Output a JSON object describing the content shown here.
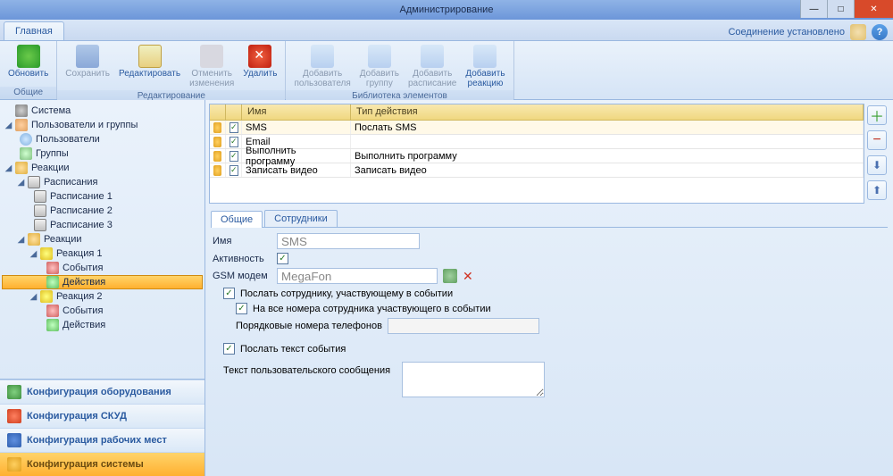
{
  "window": {
    "title": "Администрирование"
  },
  "tabbar": {
    "main": "Главная",
    "conn_status": "Соединение установлено"
  },
  "ribbon": {
    "groups": {
      "g1": {
        "title": "Общие",
        "refresh": "Обновить"
      },
      "g2": {
        "title": "Редактирование",
        "save": "Сохранить",
        "edit": "Редактировать",
        "undo": "Отменить\nизменения",
        "delete": "Удалить"
      },
      "g3": {
        "title": "Библиотека элементов",
        "add_user": "Добавить\nпользователя",
        "add_group": "Добавить\nгруппу",
        "add_sched": "Добавить\nрасписание",
        "add_react": "Добавить\nреакцию"
      }
    }
  },
  "tree": {
    "system": "Система",
    "users_groups": "Пользователи и группы",
    "users": "Пользователи",
    "groups": "Группы",
    "reactions": "Реакции",
    "schedules": "Расписания",
    "sched1": "Расписание 1",
    "sched2": "Расписание 2",
    "sched3": "Расписание 3",
    "reactions2": "Реакции",
    "react1": "Реакция 1",
    "events": "События",
    "actions": "Действия",
    "react2": "Реакция 2"
  },
  "sidebar_bottom": {
    "hw": "Конфигурация оборудования",
    "skud": "Конфигурация СКУД",
    "wp": "Конфигурация рабочих мест",
    "sys": "Конфигурация системы"
  },
  "grid": {
    "col_name": "Имя",
    "col_type": "Тип действия",
    "rows": [
      {
        "name": "SMS",
        "type": "Послать SMS"
      },
      {
        "name": "Email",
        "type": ""
      },
      {
        "name": "Выполнить программу",
        "type": "Выполнить программу"
      },
      {
        "name": "Записать видео",
        "type": "Записать видео"
      }
    ]
  },
  "detail": {
    "tab_general": "Общие",
    "tab_staff": "Сотрудники",
    "name_label": "Имя",
    "name_value": "SMS",
    "activity_label": "Активность",
    "modem_label": "GSM модем",
    "modem_value": "MegaFon",
    "send_participant": "Послать сотруднику, участвующему в событии",
    "all_numbers": "На все номера сотрудника участвующего в событии",
    "ord_numbers_label": "Порядковые номера телефонов",
    "send_text": "Послать текст события",
    "user_msg_label": "Текст пользовательского сообщения"
  }
}
